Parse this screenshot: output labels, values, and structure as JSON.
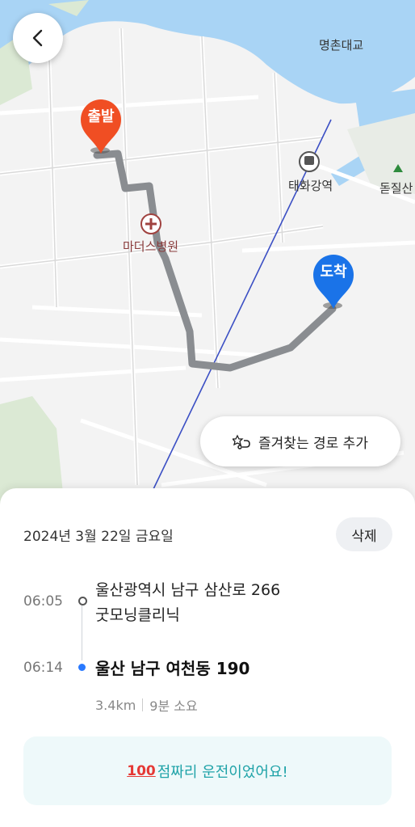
{
  "map": {
    "start_pin": "출발",
    "end_pin": "도착",
    "labels": {
      "bridge": "명촌대교",
      "station": "태화강역",
      "mountain": "돋질산",
      "hospital": "마더스병원"
    },
    "favorite_button": "즐겨찾는 경로 추가",
    "colors": {
      "start": "#f04e23",
      "end": "#1a73e8",
      "route": "#8a8d91",
      "river": "#a9d4f5"
    }
  },
  "sheet": {
    "date": "2024년 3월 22일 금요일",
    "delete_label": "삭제",
    "start": {
      "time": "06:05",
      "address_line1": "울산광역시 남구 삼산로 266",
      "address_line2": "굿모닝클리닉"
    },
    "end": {
      "time": "06:14",
      "address": "울산 남구 여천동 190"
    },
    "distance": "3.4km",
    "duration": "9분 소요",
    "badge_emoji": "100",
    "badge_text": "점짜리 운전이었어요!"
  }
}
